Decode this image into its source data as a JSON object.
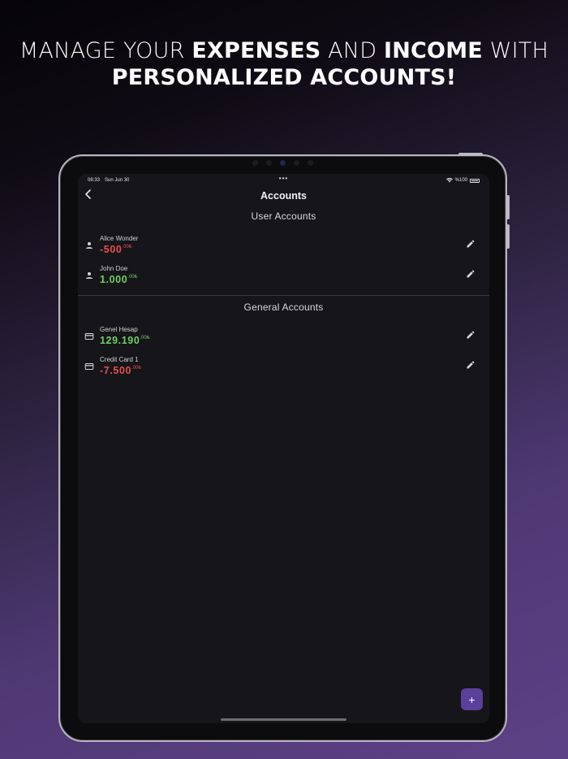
{
  "headline": {
    "line1_part1": "MANAGE YOUR ",
    "line1_bold1": "EXPENSES",
    "line1_part2": " AND ",
    "line1_bold2": "INCOME",
    "line1_part3": " WITH",
    "line2_bold": "PERSONALIZED ACCOUNTS!"
  },
  "status_bar": {
    "time": "08:33",
    "date": "Sun Jun 30",
    "dots": "•••",
    "battery": "%100"
  },
  "navbar": {
    "back_icon": "chevron-left-icon",
    "title": "Accounts"
  },
  "user_accounts": {
    "title": "User Accounts",
    "items": [
      {
        "name": "Alice Wonder",
        "amount": "-500",
        "decimals": ".00₺",
        "sign": "negative",
        "icon": "person-icon"
      },
      {
        "name": "John Doe",
        "amount": "1.000",
        "decimals": ".00₺",
        "sign": "positive",
        "icon": "person-icon"
      }
    ]
  },
  "general_accounts": {
    "title": "General Accounts",
    "items": [
      {
        "name": "Genel Hesap",
        "amount": "129.190",
        "decimals": ".00₺",
        "sign": "positive",
        "icon": "card-icon"
      },
      {
        "name": "Credit Card 1",
        "amount": "-7.500",
        "decimals": ".00₺",
        "sign": "negative",
        "icon": "card-icon"
      }
    ]
  },
  "fab": {
    "label": "+"
  },
  "colors": {
    "negative": "#e2504f",
    "positive": "#6ccf66",
    "accent": "#5b3f9a",
    "screen_bg": "#161519"
  }
}
